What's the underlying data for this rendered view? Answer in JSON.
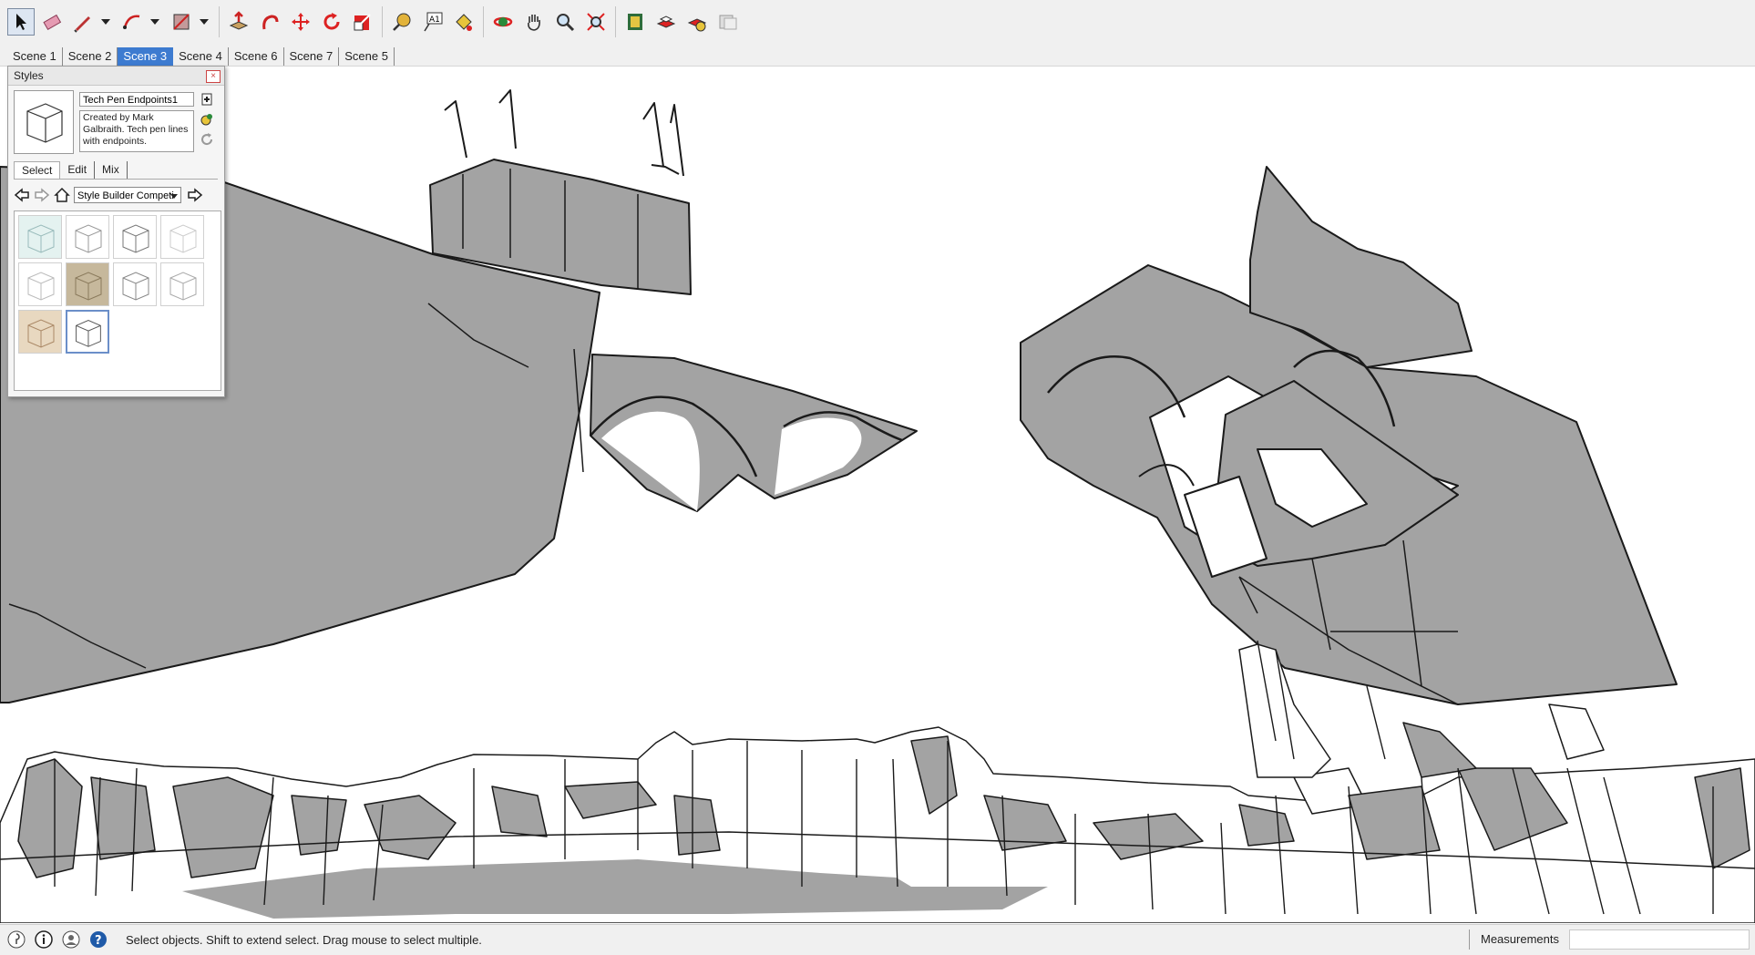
{
  "toolbar": {
    "tools": [
      "select",
      "eraser",
      "line",
      "arc",
      "rectangle",
      "push-pull",
      "follow-me",
      "move",
      "rotate",
      "scale",
      "tape-measure",
      "text",
      "paint-bucket",
      "orbit",
      "pan",
      "zoom",
      "zoom-extents",
      "previous-view",
      "warehouse",
      "components",
      "extensions"
    ]
  },
  "scenes": [
    "Scene 1",
    "Scene 2",
    "Scene 3",
    "Scene 4",
    "Scene 6",
    "Scene 7",
    "Scene 5"
  ],
  "selected_scene": "Scene 3",
  "styles_panel": {
    "title": "Styles",
    "style_name": "Tech Pen Endpoints1",
    "description": "Created by Mark Galbraith.  Tech pen lines with endpoints.",
    "tabs": [
      "Select",
      "Edit",
      "Mix"
    ],
    "collection": "Style Builder Competi"
  },
  "status": {
    "message": "Select objects. Shift to extend select. Drag mouse to select multiple.",
    "measurements_label": "Measurements",
    "measurements_value": ""
  },
  "colors": {
    "accent": "#3d7bd0",
    "fill": "#a3a3a3",
    "stroke": "#1a1a1a"
  }
}
